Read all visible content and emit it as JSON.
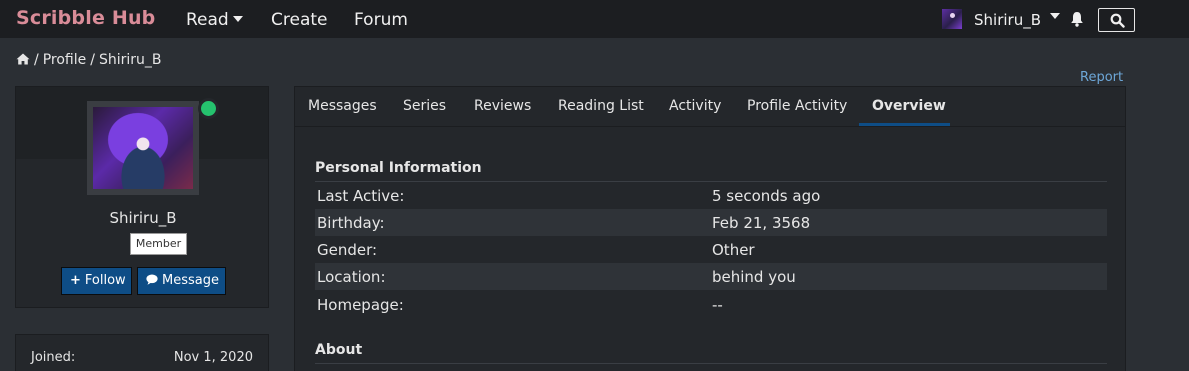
{
  "header": {
    "brand": "Scribble Hub",
    "nav": {
      "read": "Read",
      "create": "Create",
      "forum": "Forum"
    },
    "user": {
      "name": "Shiriru_B"
    },
    "icons": {
      "notifications": "bell-icon",
      "search": "search-icon",
      "dropdown": "chevron-down-icon"
    }
  },
  "breadcrumb": {
    "profile": "Profile",
    "user": "Shiriru_B",
    "separator": "/"
  },
  "report_label": "Report",
  "profile": {
    "name": "Shiriru_B",
    "role": "Member",
    "status": "online",
    "follow_label": "Follow",
    "message_label": "Message",
    "joined_label": "Joined:",
    "joined_value": "Nov 1, 2020"
  },
  "tabs": [
    {
      "label": "Messages"
    },
    {
      "label": "Series"
    },
    {
      "label": "Reviews"
    },
    {
      "label": "Reading List"
    },
    {
      "label": "Activity"
    },
    {
      "label": "Profile Activity"
    },
    {
      "label": "Overview",
      "active": true
    }
  ],
  "personal_info": {
    "title": "Personal Information",
    "rows": [
      {
        "key": "Last Active:",
        "value": "5 seconds ago"
      },
      {
        "key": "Birthday:",
        "value": "Feb 21, 3568"
      },
      {
        "key": "Gender:",
        "value": "Other"
      },
      {
        "key": "Location:",
        "value": "behind you"
      },
      {
        "key": "Homepage:",
        "value": "--"
      }
    ]
  },
  "about": {
    "title": "About"
  },
  "colors": {
    "brand": "#d98c98",
    "accent": "#0e4d86",
    "online": "#25c26e",
    "link": "#6da7d8",
    "background": "#2b2f34"
  }
}
